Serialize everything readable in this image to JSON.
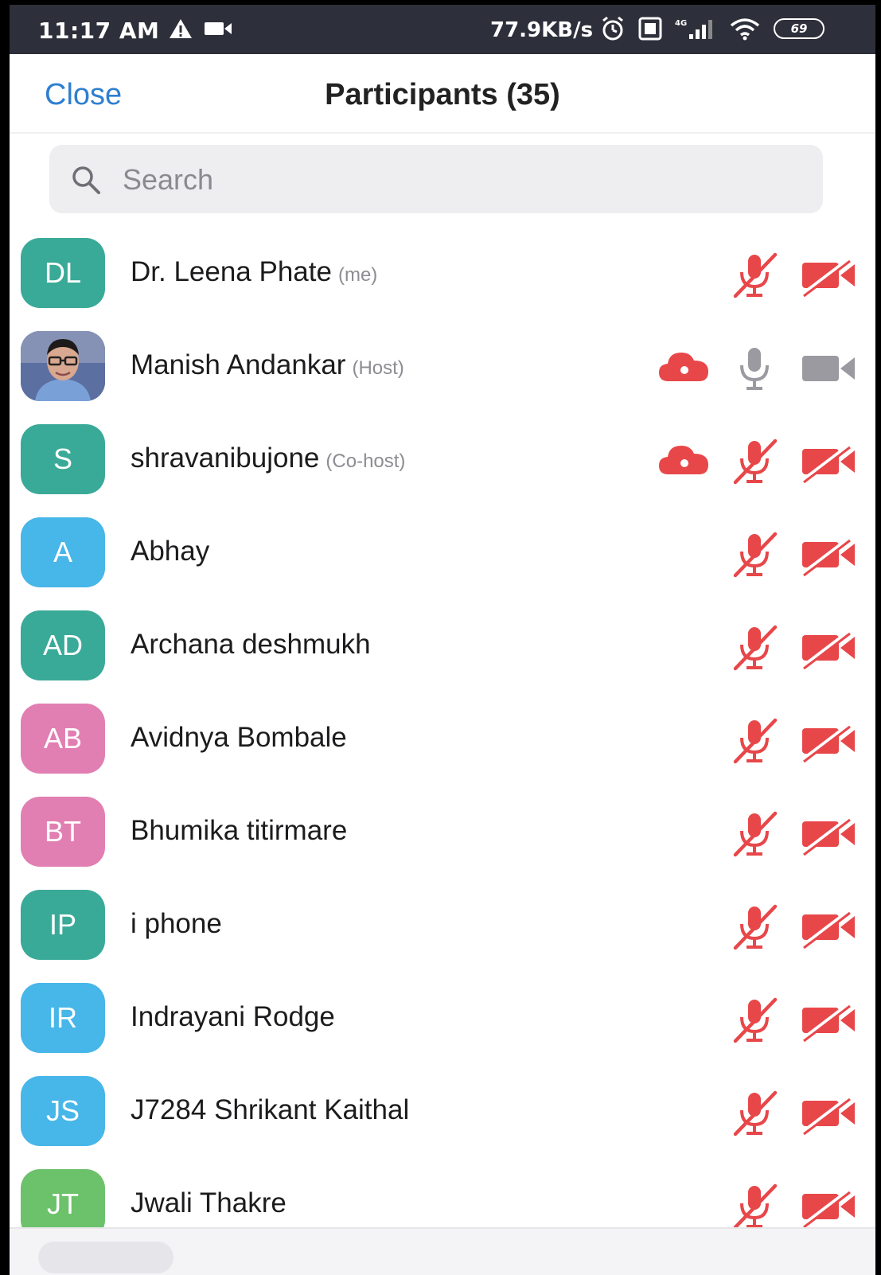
{
  "status_bar": {
    "time": "11:17 AM",
    "speed": "77.9KB/s",
    "battery": "69",
    "icons": [
      "warning-icon",
      "video-record-icon",
      "alarm-icon",
      "sim-icon",
      "signal-icon",
      "wifi-icon",
      "battery-icon"
    ]
  },
  "header": {
    "close_label": "Close",
    "title": "Participants (35)"
  },
  "search": {
    "placeholder": "Search"
  },
  "colors": {
    "teal": "#3aaa98",
    "blue": "#47b6e8",
    "pink": "#e27fb2",
    "green": "#6cc16b",
    "muted_red": "#e8474a",
    "inactive_grey": "#9a9aa0",
    "link_blue": "#2e7fd0"
  },
  "participants": [
    {
      "initials": "DL",
      "name": "Dr. Leena Phate",
      "role": "(me)",
      "avatar_color": "#3aaa98",
      "photo": false,
      "cloud": false,
      "mic_muted": true,
      "cam_off": true
    },
    {
      "initials": "",
      "name": "Manish Andankar",
      "role": "(Host)",
      "avatar_color": "#5b6fa0",
      "photo": true,
      "cloud": true,
      "mic_muted": false,
      "cam_off": false
    },
    {
      "initials": "S",
      "name": "shravanibujone",
      "role": "(Co-host)",
      "avatar_color": "#3aaa98",
      "photo": false,
      "cloud": true,
      "mic_muted": true,
      "cam_off": true
    },
    {
      "initials": "A",
      "name": "Abhay",
      "role": "",
      "avatar_color": "#47b6e8",
      "photo": false,
      "cloud": false,
      "mic_muted": true,
      "cam_off": true
    },
    {
      "initials": "AD",
      "name": "Archana deshmukh",
      "role": "",
      "avatar_color": "#3aaa98",
      "photo": false,
      "cloud": false,
      "mic_muted": true,
      "cam_off": true
    },
    {
      "initials": "AB",
      "name": "Avidnya Bombale",
      "role": "",
      "avatar_color": "#e27fb2",
      "photo": false,
      "cloud": false,
      "mic_muted": true,
      "cam_off": true
    },
    {
      "initials": "BT",
      "name": "Bhumika titirmare",
      "role": "",
      "avatar_color": "#e27fb2",
      "photo": false,
      "cloud": false,
      "mic_muted": true,
      "cam_off": true
    },
    {
      "initials": "IP",
      "name": "i phone",
      "role": "",
      "avatar_color": "#3aaa98",
      "photo": false,
      "cloud": false,
      "mic_muted": true,
      "cam_off": true
    },
    {
      "initials": "IR",
      "name": "Indrayani Rodge",
      "role": "",
      "avatar_color": "#47b6e8",
      "photo": false,
      "cloud": false,
      "mic_muted": true,
      "cam_off": true
    },
    {
      "initials": "JS",
      "name": "J7284 Shrikant Kaithal",
      "role": "",
      "avatar_color": "#47b6e8",
      "photo": false,
      "cloud": false,
      "mic_muted": true,
      "cam_off": true
    },
    {
      "initials": "JT",
      "name": "Jwali Thakre",
      "role": "",
      "avatar_color": "#6cc16b",
      "photo": false,
      "cloud": false,
      "mic_muted": true,
      "cam_off": true
    }
  ]
}
